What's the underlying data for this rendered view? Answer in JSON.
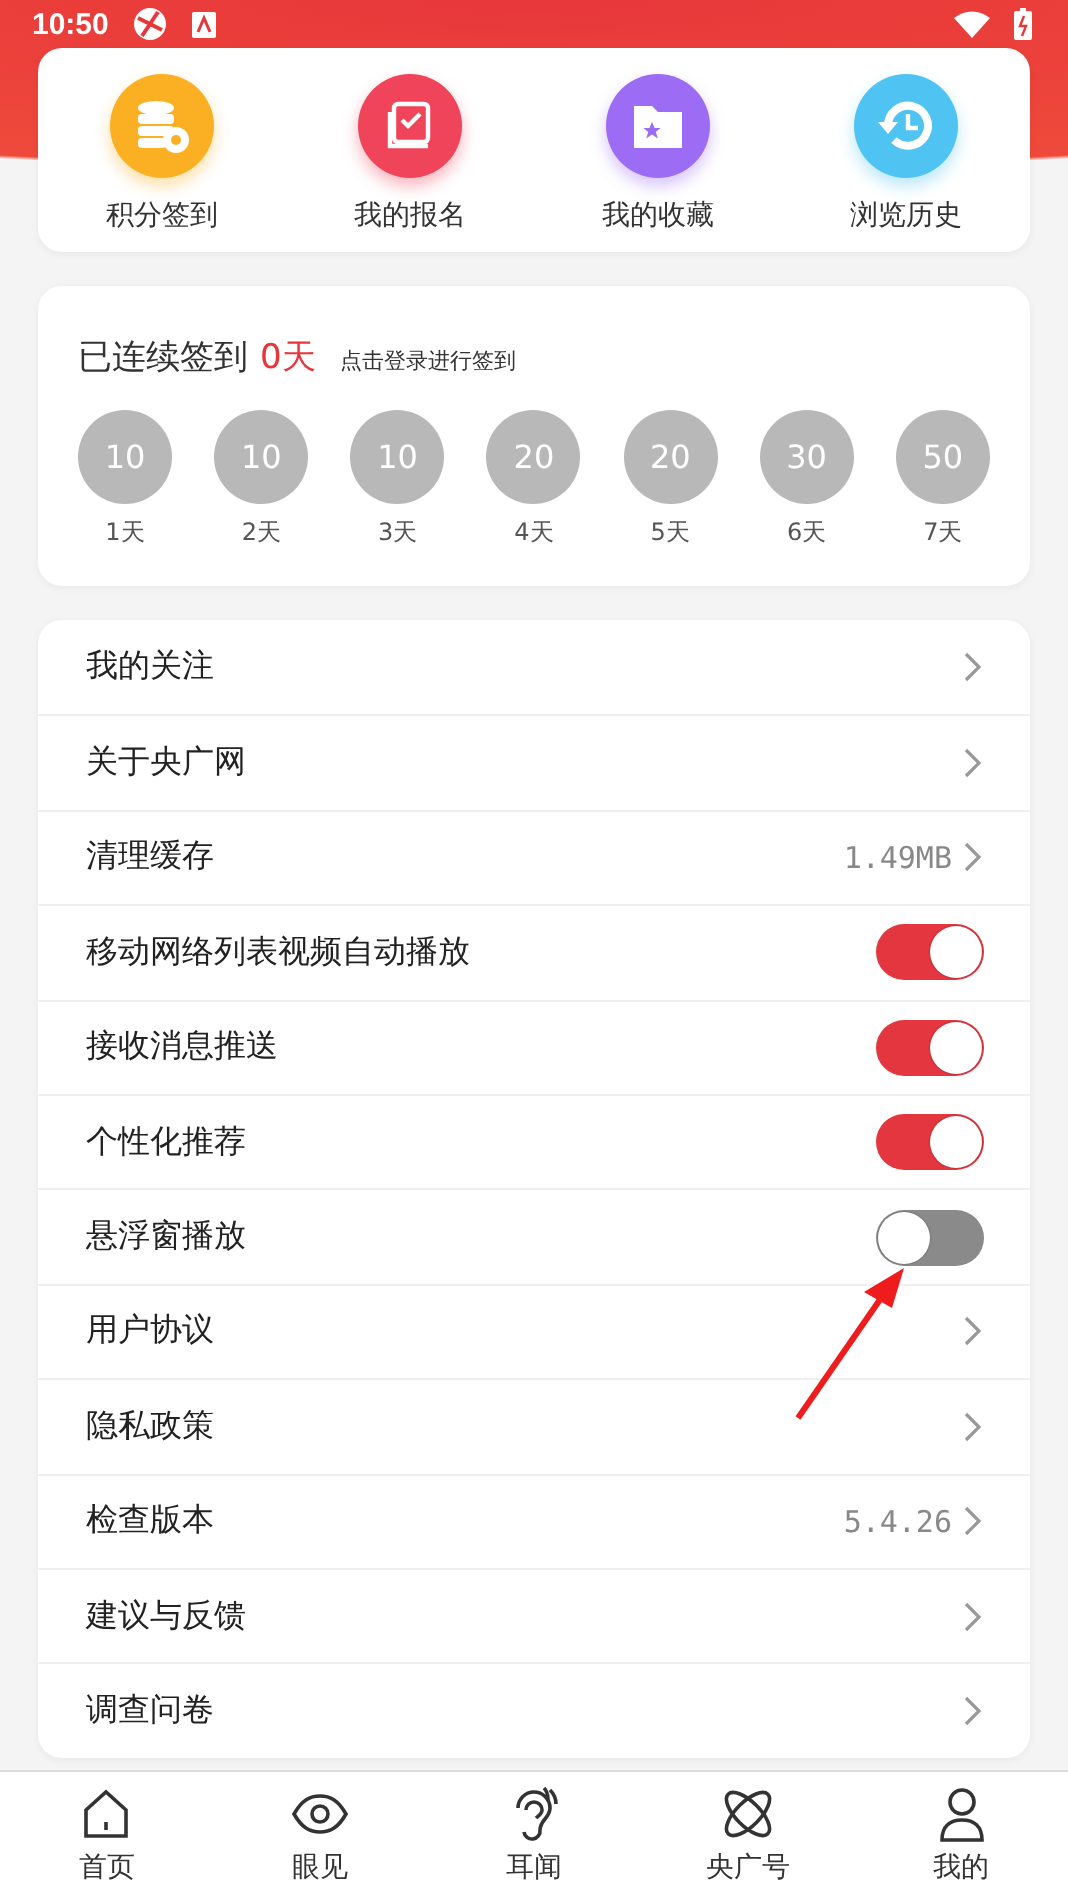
{
  "status_bar": {
    "time": "10:50"
  },
  "shortcuts": [
    {
      "label": "积分签到",
      "color": "#fbb024"
    },
    {
      "label": "我的报名",
      "color": "#f0445a"
    },
    {
      "label": "我的收藏",
      "color": "#9c6cf5"
    },
    {
      "label": "浏览历史",
      "color": "#4fc3f2"
    }
  ],
  "checkin": {
    "title": "已连续签到",
    "days": "0天",
    "hint": "点击登录进行签到",
    "steps": [
      {
        "points": "10",
        "day": "1天",
        "done": false
      },
      {
        "points": "10",
        "day": "2天",
        "done": false
      },
      {
        "points": "10",
        "day": "3天",
        "done": false
      },
      {
        "points": "20",
        "day": "4天",
        "done": false
      },
      {
        "points": "20",
        "day": "5天",
        "done": false
      },
      {
        "points": "30",
        "day": "6天",
        "done": false
      },
      {
        "points": "50",
        "day": "7天",
        "done": false
      }
    ]
  },
  "settings": [
    {
      "kind": "link",
      "label": "我的关注"
    },
    {
      "kind": "link",
      "label": "关于央广网"
    },
    {
      "kind": "value",
      "label": "清理缓存",
      "value": "1.49MB"
    },
    {
      "kind": "toggle",
      "label": "移动网络列表视频自动播放",
      "on": true
    },
    {
      "kind": "toggle",
      "label": "接收消息推送",
      "on": true
    },
    {
      "kind": "toggle",
      "label": "个性化推荐",
      "on": true
    },
    {
      "kind": "toggle",
      "label": "悬浮窗播放",
      "on": false
    },
    {
      "kind": "link",
      "label": "用户协议"
    },
    {
      "kind": "link",
      "label": "隐私政策"
    },
    {
      "kind": "value",
      "label": "检查版本",
      "value": "5.4.26"
    },
    {
      "kind": "link",
      "label": "建议与反馈"
    },
    {
      "kind": "link",
      "label": "调查问卷"
    }
  ],
  "nav": [
    {
      "label": "首页",
      "selected": false
    },
    {
      "label": "眼见",
      "selected": false
    },
    {
      "label": "耳闻",
      "selected": false
    },
    {
      "label": "央广号",
      "selected": false
    },
    {
      "label": "我的",
      "selected": false
    }
  ]
}
